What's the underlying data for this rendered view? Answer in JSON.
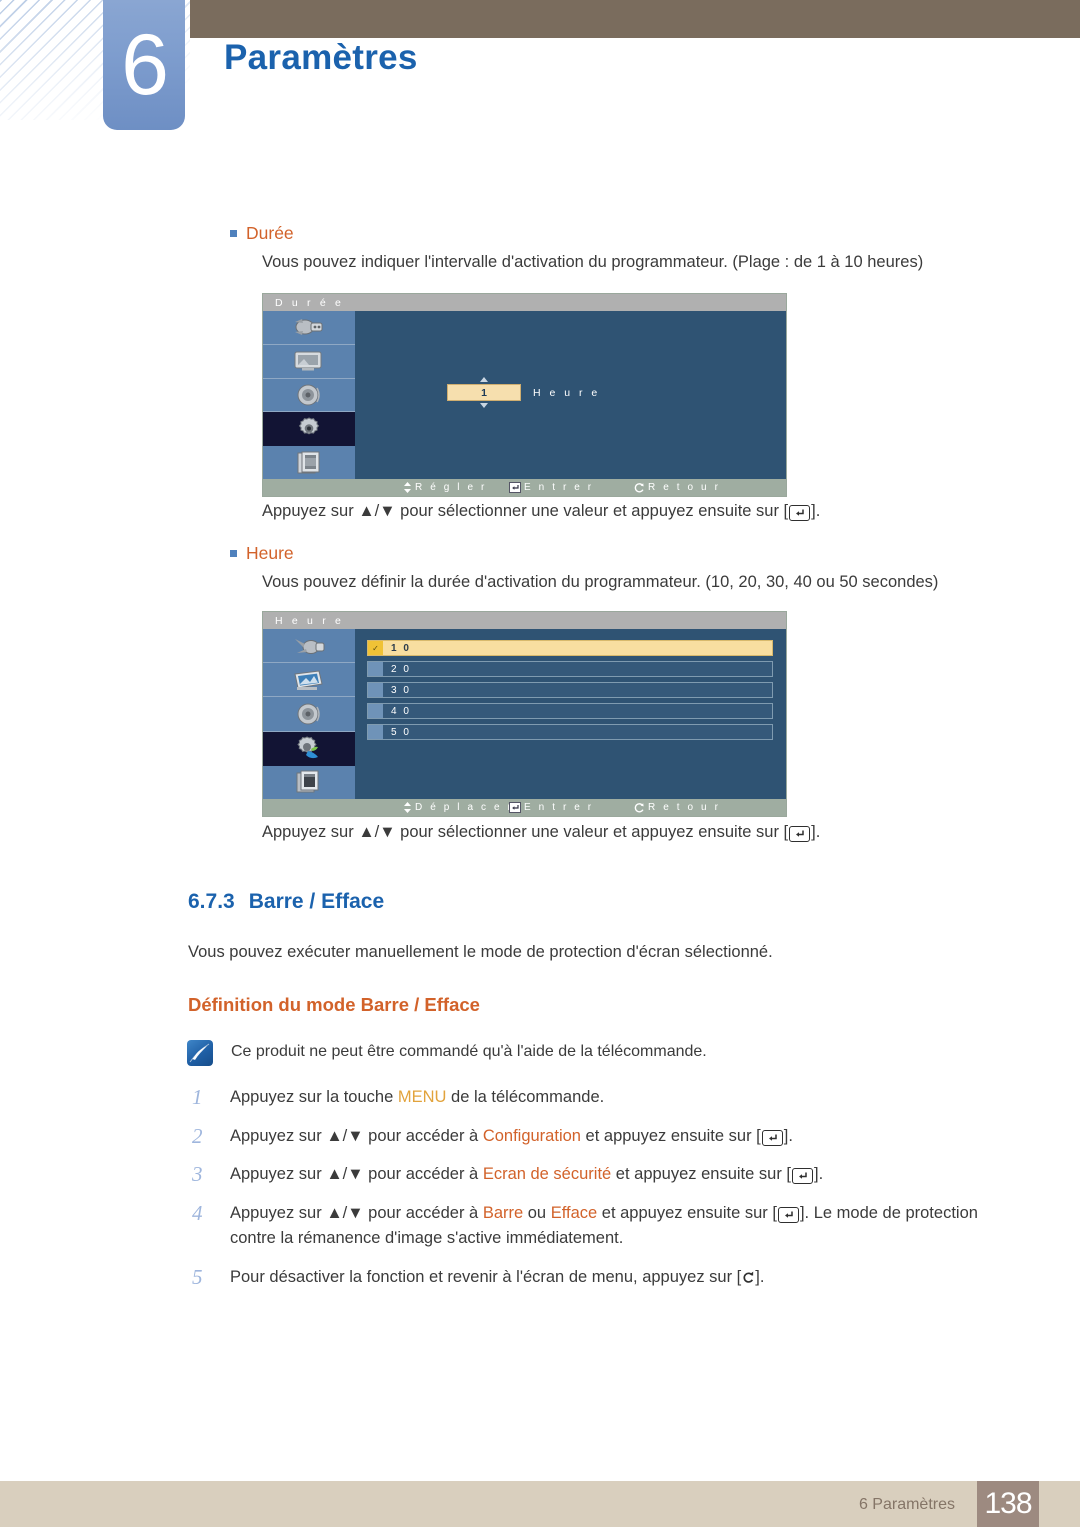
{
  "header": {
    "chapter_number": "6",
    "chapter_title": "Paramètres"
  },
  "sections": {
    "duree": {
      "bullet_label": "Durée",
      "description": "Vous pouvez indiquer l'intervalle d'activation du programmateur. (Plage : de 1 à 10 heures)",
      "instruction_prefix": "Appuyez sur ",
      "instruction_mid": " pour sélectionner une valeur et appuyez ensuite sur [",
      "instruction_suffix": "].",
      "arrows": "▲/▼",
      "osd": {
        "title": "D u r é e",
        "value": "1",
        "unit": "H e u r e",
        "sidebar_icons": [
          "input-plug-icon",
          "picture-screen-icon",
          "sound-speaker-icon",
          "setup-gear-icon",
          "multi-control-books-icon"
        ],
        "selected_sidebar_index": 3,
        "footer": [
          {
            "icon": "updown-arrow-icon",
            "label": "R é g l e r"
          },
          {
            "icon": "enter-key-icon",
            "label": "E n t r e r"
          },
          {
            "icon": "return-arrow-icon",
            "label": "R e t o u r"
          }
        ]
      }
    },
    "heure": {
      "bullet_label": "Heure",
      "description": "Vous pouvez définir la durée d'activation du programmateur. (10, 20, 30, 40 ou 50 secondes)",
      "instruction_prefix": "Appuyez sur ",
      "instruction_mid": " pour sélectionner une valeur et appuyez ensuite sur [",
      "instruction_suffix": "].",
      "arrows": "▲/▼",
      "osd": {
        "title": "H e u r e",
        "options": [
          "1 0",
          "2 0",
          "3 0",
          "4 0",
          "5 0"
        ],
        "selected_option_index": 0,
        "check_glyph": "✓",
        "sidebar_icons": [
          "input-plug-icon",
          "picture-screen-icon",
          "sound-speaker-icon",
          "setup-gear-icon",
          "multi-control-books-icon"
        ],
        "selected_sidebar_index": 3,
        "footer": [
          {
            "icon": "updown-arrow-icon",
            "label": "D é p l a c e r"
          },
          {
            "icon": "enter-key-icon",
            "label": "E n t r e r"
          },
          {
            "icon": "return-arrow-icon",
            "label": "R e t o u r"
          }
        ]
      }
    }
  },
  "subsection": {
    "number": "6.7.3",
    "title": "Barre / Efface",
    "intro": "Vous pouvez exécuter manuellement le mode de protection d'écran sélectionné.",
    "heading": "Définition du mode Barre / Efface",
    "note": "Ce produit ne peut être commandé qu'à l'aide de la télécommande."
  },
  "steps": [
    {
      "num": "1",
      "parts": [
        {
          "t": "Appuyez sur la touche ",
          "k": "plain"
        },
        {
          "t": "MENU",
          "k": "menu"
        },
        {
          "t": " de la télécommande.",
          "k": "plain"
        }
      ]
    },
    {
      "num": "2",
      "parts": [
        {
          "t": "Appuyez sur ",
          "k": "plain"
        },
        {
          "t": "▲/▼",
          "k": "arrows"
        },
        {
          "t": " pour accéder à ",
          "k": "plain"
        },
        {
          "t": "Configuration",
          "k": "kw"
        },
        {
          "t": " et appuyez ensuite sur [",
          "k": "plain"
        },
        {
          "t": "enter-key-icon",
          "k": "key"
        },
        {
          "t": "].",
          "k": "plain"
        }
      ]
    },
    {
      "num": "3",
      "parts": [
        {
          "t": "Appuyez sur ",
          "k": "plain"
        },
        {
          "t": "▲/▼",
          "k": "arrows"
        },
        {
          "t": " pour accéder à ",
          "k": "plain"
        },
        {
          "t": "Ecran de sécurité",
          "k": "kw"
        },
        {
          "t": " et appuyez ensuite sur [",
          "k": "plain"
        },
        {
          "t": "enter-key-icon",
          "k": "key"
        },
        {
          "t": "].",
          "k": "plain"
        }
      ]
    },
    {
      "num": "4",
      "parts": [
        {
          "t": "Appuyez sur ",
          "k": "plain"
        },
        {
          "t": "▲/▼",
          "k": "arrows"
        },
        {
          "t": " pour accéder à ",
          "k": "plain"
        },
        {
          "t": "Barre",
          "k": "kw"
        },
        {
          "t": " ou ",
          "k": "plain"
        },
        {
          "t": "Efface",
          "k": "kw"
        },
        {
          "t": " et appuyez ensuite sur [",
          "k": "plain"
        },
        {
          "t": "enter-key-icon",
          "k": "key"
        },
        {
          "t": "]. Le mode de protection contre la rémanence d'image s'active immédiatement.",
          "k": "plain"
        }
      ]
    },
    {
      "num": "5",
      "parts": [
        {
          "t": "Pour désactiver la fonction et revenir à l'écran de menu, appuyez sur [",
          "k": "plain"
        },
        {
          "t": "return-arrow-icon",
          "k": "retkey"
        },
        {
          "t": "].",
          "k": "plain"
        }
      ]
    }
  ],
  "footer": {
    "label": "6 Paramètres",
    "page": "138"
  },
  "colors": {
    "chapter_blue": "#1b62ad",
    "accent_orange": "#d2622a",
    "header_brown": "#7a6c5d",
    "footer_tan": "#d9cfbe",
    "page_box": "#9d8a80",
    "osd_blue": "#2f5373",
    "osd_highlight": "#f8dea0"
  }
}
